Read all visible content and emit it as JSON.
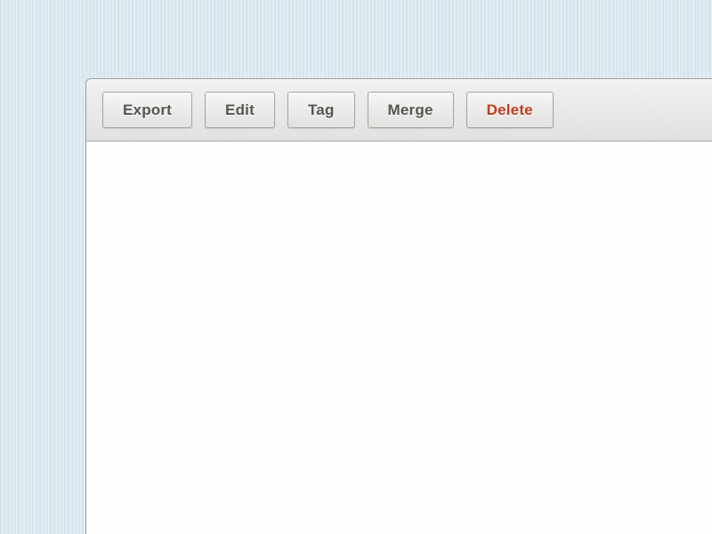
{
  "toolbar": {
    "buttons": [
      {
        "label": "Export",
        "name": "export-button",
        "danger": false
      },
      {
        "label": "Edit",
        "name": "edit-button",
        "danger": false
      },
      {
        "label": "Tag",
        "name": "tag-button",
        "danger": false
      },
      {
        "label": "Merge",
        "name": "merge-button",
        "danger": false
      },
      {
        "label": "Delete",
        "name": "delete-button",
        "danger": true
      }
    ]
  }
}
